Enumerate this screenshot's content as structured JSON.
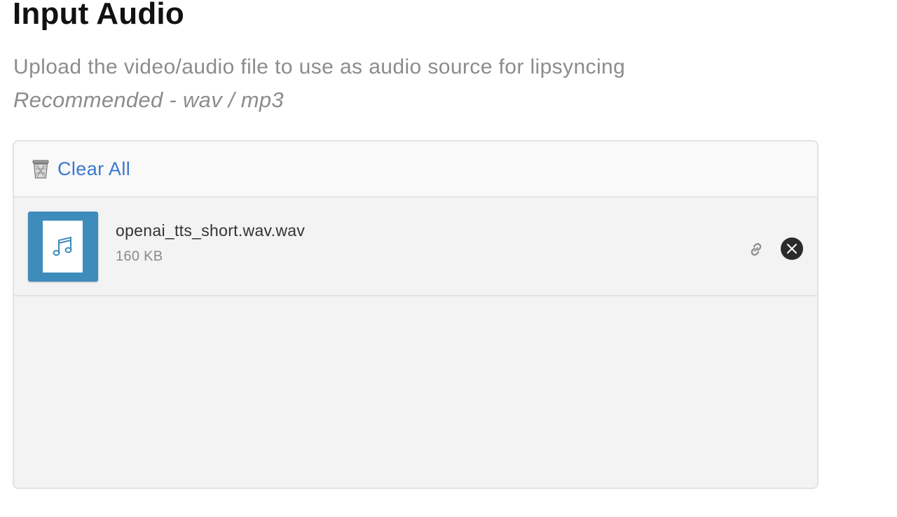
{
  "header": {
    "title": "Input Audio",
    "subtitle": "Upload the video/audio file to use as audio source for lipsyncing",
    "recommendation": "Recommended - wav / mp3"
  },
  "uploader": {
    "clear_all_label": "Clear All",
    "clear_all_icon": "trash-icon",
    "files": [
      {
        "name": "openai_tts_short.wav.wav",
        "size": "160 KB",
        "thumbnail_icon": "music-note-icon",
        "actions": [
          "link-icon",
          "close-icon"
        ]
      }
    ]
  },
  "colors": {
    "accent": "#3a78cf",
    "thumbnail_bg": "#3d8cbb",
    "remove_button_bg": "#2b2b2b",
    "panel_bg": "#f3f3f3"
  }
}
